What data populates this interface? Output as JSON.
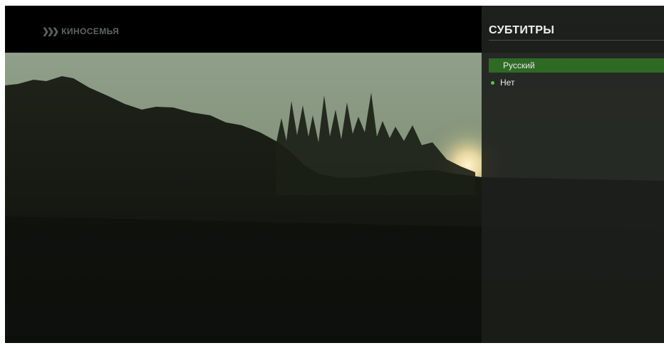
{
  "brand": {
    "logo_chevrons": "❯❯❯",
    "logo_text": "КИНОСЕМЬЯ"
  },
  "panel": {
    "title": "СУБТИТРЫ",
    "options": [
      {
        "label": "Русский",
        "state": "highlighted"
      },
      {
        "label": "Нет",
        "state": "active"
      }
    ]
  },
  "colors": {
    "highlight": "#2f6a25",
    "active_dot": "#57c54a",
    "panel_bg": "#1f211f"
  }
}
